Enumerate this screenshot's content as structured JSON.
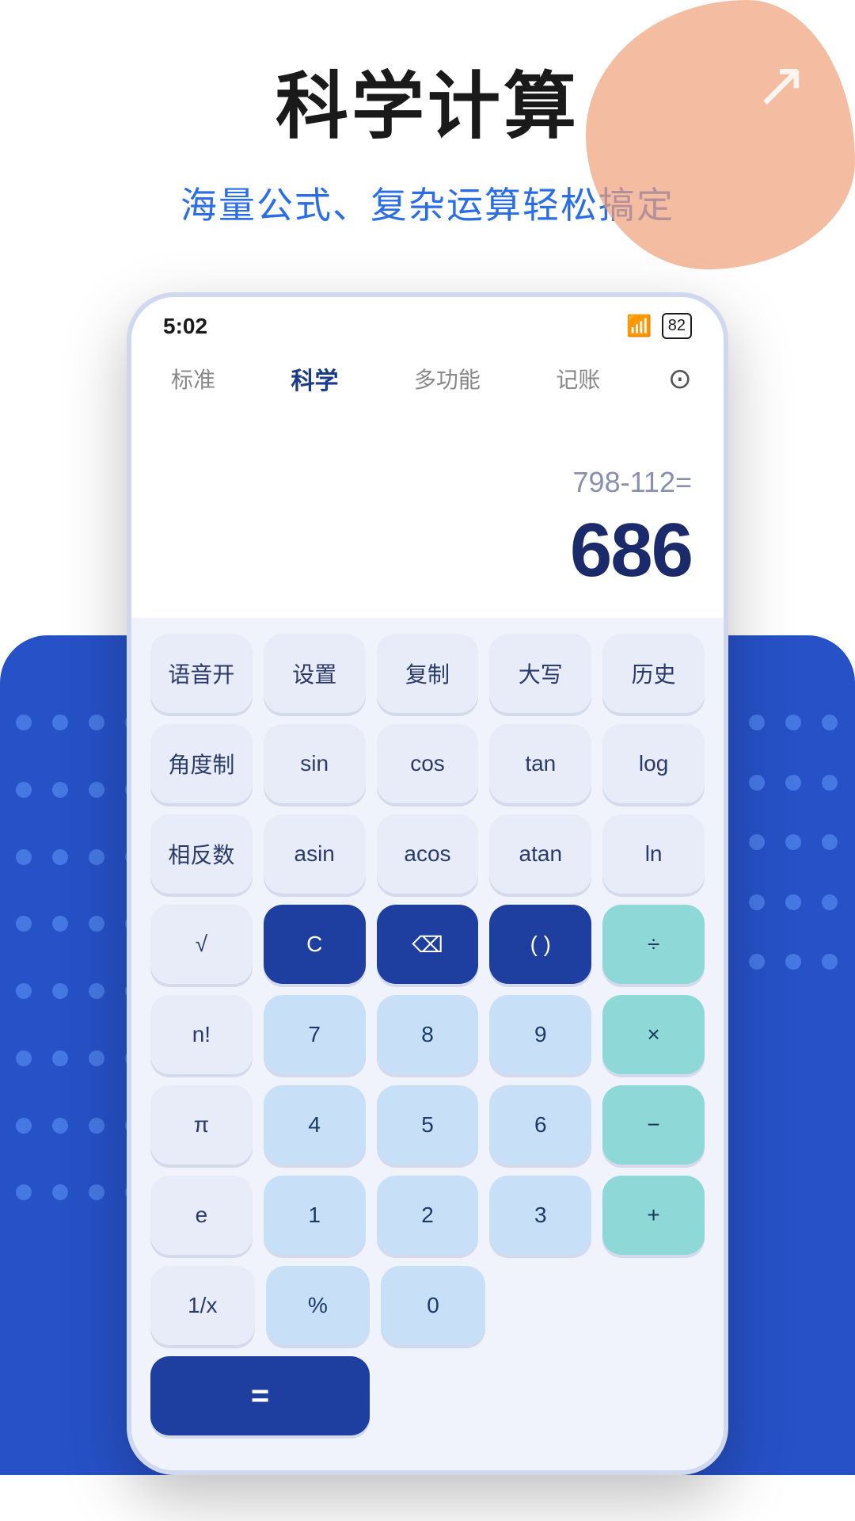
{
  "page": {
    "main_title": "科学计算",
    "subtitle": "海量公式、复杂运算轻松搞定"
  },
  "status_bar": {
    "time": "5:02",
    "battery": "82"
  },
  "tabs": [
    {
      "id": "standard",
      "label": "标准",
      "active": false
    },
    {
      "id": "science",
      "label": "科学",
      "active": true
    },
    {
      "id": "multi",
      "label": "多功能",
      "active": false
    },
    {
      "id": "bookkeeping",
      "label": "记账",
      "active": false
    }
  ],
  "display": {
    "expression": "798-112=",
    "result": "686"
  },
  "buttons": {
    "row1": [
      "语音开",
      "设置",
      "复制",
      "大写",
      "历史"
    ],
    "row2": [
      "角度制",
      "sin",
      "cos",
      "tan",
      "log"
    ],
    "row3": [
      "相反数",
      "asin",
      "acos",
      "atan",
      "ln"
    ],
    "row4": [
      "√",
      "C",
      "⌫",
      "( )",
      "÷"
    ],
    "row5": [
      "n!",
      "7",
      "8",
      "9",
      "×"
    ],
    "row6": [
      "π",
      "4",
      "5",
      "6",
      "−"
    ],
    "row7": [
      "e",
      "1",
      "2",
      "3",
      "+"
    ],
    "row8": [
      "1/x",
      "%",
      "0",
      ".",
      "="
    ]
  },
  "colors": {
    "blue_dark": "#1e3fa0",
    "blue_bg": "#2651c7",
    "teal": "#8ed8d8",
    "light_blue_btn": "#c8dff8",
    "light_btn": "#e8ecf8",
    "text_dark": "#2a3a6a",
    "text_result": "#1a2a6a",
    "text_expr": "#8890b0",
    "tab_active": "#1a3a8a",
    "tab_inactive": "#888888",
    "accent_blue": "#2a6de8"
  }
}
